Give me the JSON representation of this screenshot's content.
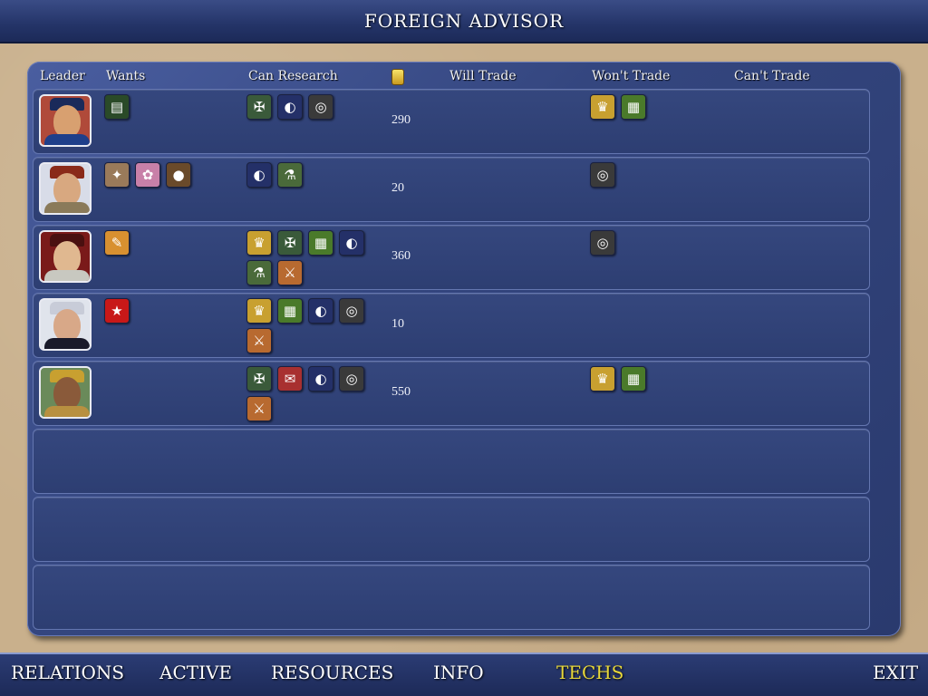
{
  "title": "FOREIGN ADVISOR",
  "columns": {
    "leader": "Leader",
    "wants": "Wants",
    "can_research": "Can Research",
    "gold_icon": "gold-coin-icon",
    "will_trade": "Will Trade",
    "wont_trade": "Won't Trade",
    "cant_trade": "Can't Trade"
  },
  "rows": [
    {
      "leader": "chinese-leader-portrait",
      "gold": "290"
    },
    {
      "leader": "russian-leader-portrait",
      "gold": "20"
    },
    {
      "leader": "spanish-leader-portrait",
      "gold": "360"
    },
    {
      "leader": "english-leader-portrait",
      "gold": "10"
    },
    {
      "leader": "african-leader-portrait",
      "gold": "550"
    }
  ],
  "nav": {
    "relations": "RELATIONS",
    "active": "ACTIVE",
    "resources": "RESOURCES",
    "info": "INFO",
    "techs": "TECHS",
    "exit": "EXIT"
  },
  "colors": {
    "panel": "#34467f",
    "active_tab": "#e8d83a"
  }
}
